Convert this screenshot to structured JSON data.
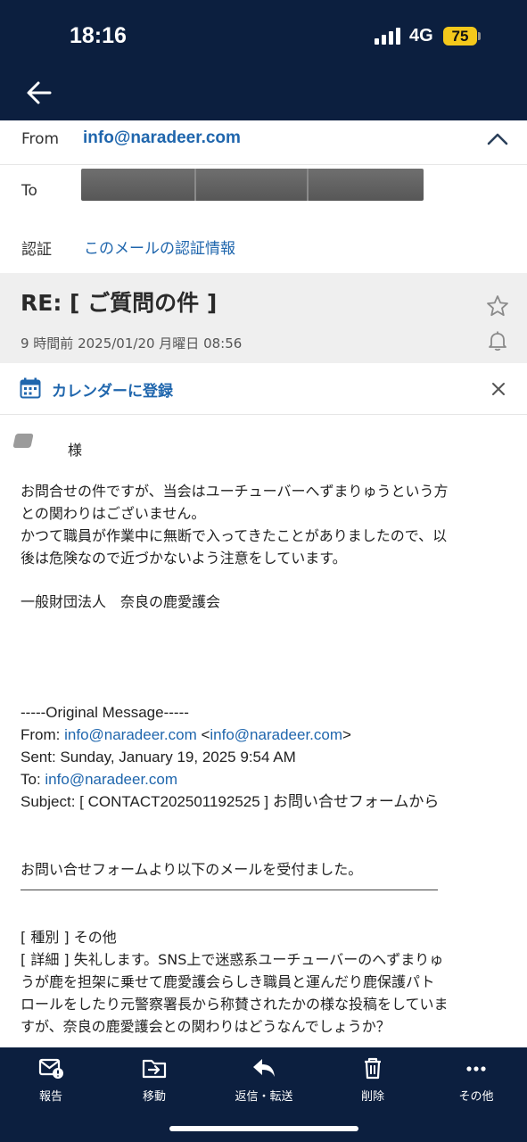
{
  "status_bar": {
    "time": "18:16",
    "network": "4G",
    "battery": "75"
  },
  "header": {
    "from_label": "From",
    "from_address": "info@naradeer.com",
    "to_label": "To",
    "auth_label": "認証",
    "auth_link": "このメールの認証情報"
  },
  "subject": {
    "title": "RE: [ ご質問の件 ]",
    "date": "9 時間前 2025/01/20 月曜日 08:56"
  },
  "calendar": {
    "label": "カレンダーに登録"
  },
  "body": {
    "salutation": "様",
    "para1_line1": "お問合せの件ですが、当会はユーチューバーへずまりゅうという方",
    "para1_line2": "との関わりはございません。",
    "para1_line3": "かつて職員が作業中に無断で入ってきたことがありましたので、以",
    "para1_line4": "後は危険なので近づかないよう注意をしています。",
    "signature": "一般財団法人　奈良の鹿愛護会",
    "original": {
      "header": "-----Original Message-----",
      "from_prefix": "From: ",
      "from_addr": "info@naradeer.com",
      "from_open": " <",
      "from_addr2": "info@naradeer.com",
      "from_close": ">",
      "sent": "Sent: Sunday, January 19, 2025 9:54 AM",
      "to_prefix": "To: ",
      "to_addr": "info@naradeer.com",
      "subject": "Subject: [ CONTACT202501192525 ] お問い合せフォームから"
    },
    "received_line": "お問い合せフォームより以下のメールを受付ました。",
    "category": "[ 種別 ] その他",
    "detail_line1": "[ 詳細 ] 失礼します。SNS上で迷惑系ユーチューバーのへずまりゅ",
    "detail_line2": "うが鹿を担架に乗せて鹿愛護会らしき職員と運んだり鹿保護パト",
    "detail_line3": "ロールをしたり元警察署長から称賛されたかの様な投稿をしていま",
    "detail_line4": "すが、奈良の鹿愛護会との関わりはどうなんでしょうか？"
  },
  "toolbar": {
    "report": "報告",
    "move": "移動",
    "reply": "返信・転送",
    "delete": "削除",
    "more": "その他"
  },
  "colors": {
    "navy": "#0c1f3f",
    "link_blue": "#1f66ad",
    "battery_yellow": "#f4c81b"
  }
}
